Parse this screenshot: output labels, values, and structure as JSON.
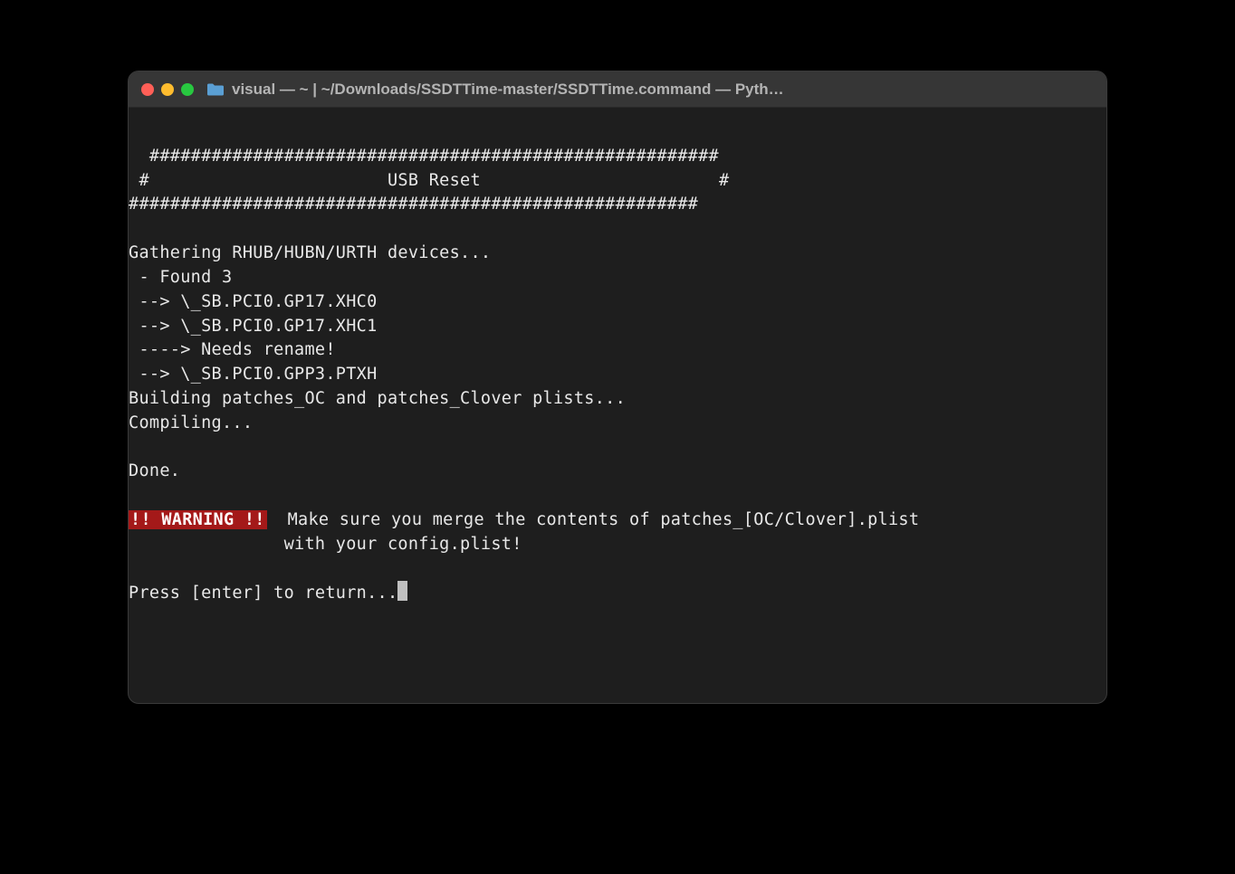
{
  "window": {
    "title": "visual — ~ | ~/Downloads/SSDTTime-master/SSDTTime.command — Pyth…"
  },
  "terminal": {
    "header_border_top": "  #######################################################",
    "header_title_line": " #                       USB Reset                       #",
    "header_border_bottom": "#######################################################",
    "blank": "",
    "line_gather": "Gathering RHUB/HUBN/URTH devices...",
    "line_found": " - Found 3",
    "line_dev1": " --> \\_SB.PCI0.GP17.XHC0",
    "line_dev2": " --> \\_SB.PCI0.GP17.XHC1",
    "line_rename": " ----> Needs rename!",
    "line_dev3": " --> \\_SB.PCI0.GPP3.PTXH",
    "line_building": "Building patches_OC and patches_Clover plists...",
    "line_compiling": "Compiling...",
    "line_done": "Done.",
    "warning_badge": "!! WARNING !!",
    "warning_text1": "  Make sure you merge the contents of patches_[OC/Clover].plist",
    "warning_text2": "               with your config.plist!",
    "prompt": "Press [enter] to return..."
  }
}
